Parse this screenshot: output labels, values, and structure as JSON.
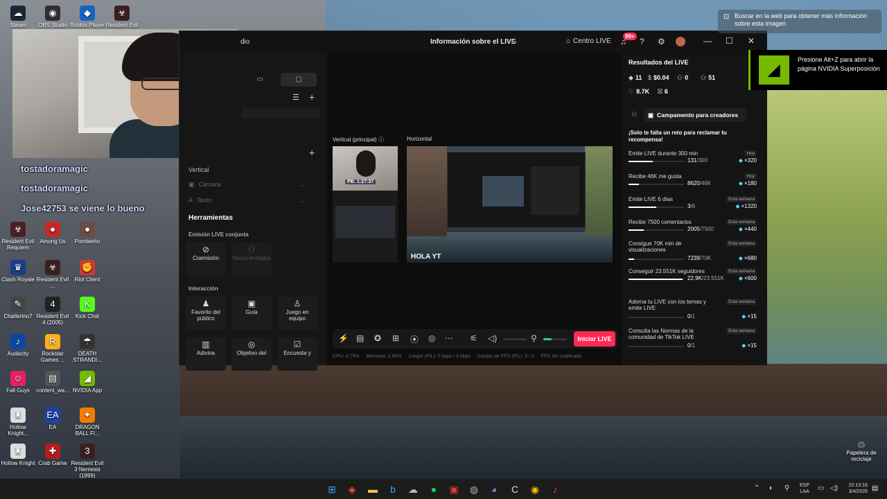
{
  "desktop_icons": [
    {
      "label": "Steam",
      "glyph": "☁",
      "color": "#1b2838"
    },
    {
      "label": "OBS Studio",
      "glyph": "◉",
      "color": "#302e31"
    },
    {
      "label": "Roblox Player",
      "glyph": "◆",
      "color": "#1565c0"
    },
    {
      "label": "Resident Evil ...",
      "glyph": "☣",
      "color": "#3b1f1f"
    },
    {
      "label": "Resident Evil Requiem",
      "glyph": "☣",
      "color": "#4a2020"
    },
    {
      "label": "Among Us",
      "glyph": "●",
      "color": "#c62828"
    },
    {
      "label": "Pomberito",
      "glyph": "●",
      "color": "#6d4c41"
    },
    {
      "label": "Clash Royale",
      "glyph": "♛",
      "color": "#1e3a8a"
    },
    {
      "label": "Resident Evil ...",
      "glyph": "☣",
      "color": "#3b1f1f"
    },
    {
      "label": "Riot Client",
      "glyph": "✊",
      "color": "#d13639"
    },
    {
      "label": "Chatterino7",
      "glyph": "✎",
      "color": "#444"
    },
    {
      "label": "Resident Evil 4 (2005)",
      "glyph": "4",
      "color": "#222"
    },
    {
      "label": "Kick Chat",
      "glyph": "K",
      "color": "#53fc18"
    },
    {
      "label": "Audacity",
      "glyph": "♪",
      "color": "#0d47a1"
    },
    {
      "label": "Rockstar Games ...",
      "glyph": "R",
      "color": "#fcaf17"
    },
    {
      "label": "DEATH STRANDI...",
      "glyph": "☂",
      "color": "#333"
    },
    {
      "label": "Fall Guys",
      "glyph": "☺",
      "color": "#e91e63"
    },
    {
      "label": "content_wa...",
      "glyph": "▤",
      "color": "#555"
    },
    {
      "label": "NVIDIA App",
      "glyph": "◢",
      "color": "#76b900"
    },
    {
      "label": "Hollow Knight...",
      "glyph": "♜",
      "color": "#ddd"
    },
    {
      "label": "EA",
      "glyph": "EA",
      "color": "#1e40af"
    },
    {
      "label": "DRAGON BALL Fi...",
      "glyph": "✦",
      "color": "#f57c00"
    },
    {
      "label": "Hollow Knight",
      "glyph": "♜",
      "color": "#ddd"
    },
    {
      "label": "Crab Game",
      "glyph": "✚",
      "color": "#b71c1c"
    },
    {
      "label": "Resident Evil 3 Nemesis (1999)",
      "glyph": "3",
      "color": "#3b1f1f"
    }
  ],
  "chat_overlay": [
    {
      "user": "tostadoramagic",
      "text": ""
    },
    {
      "user": "tostadoramagic",
      "text": ""
    },
    {
      "user": "Jose42753",
      "text": "se viene lo bueno"
    }
  ],
  "app": {
    "name": "dio",
    "title": "Información sobre el LIVE",
    "centro_live": "Centro LIVE",
    "notif_badge": "99+",
    "left": {
      "vertical_label": "Vertical",
      "sources": [
        "Cámara",
        "Texto"
      ],
      "tools_title": "Herramientas",
      "section_joint": "Emisión LIVE conjunta",
      "tools_joint": [
        {
          "label": "Coemisión",
          "icon": "⊘",
          "disabled": false
        },
        {
          "label": "Varios invitados",
          "icon": "⚇",
          "disabled": true
        }
      ],
      "section_interaction": "Interacción",
      "tools_interaction": [
        {
          "label": "Favorito del público",
          "icon": "♟",
          "disabled": false
        },
        {
          "label": "Guía",
          "icon": "▣",
          "disabled": false
        },
        {
          "label": "Juego en equipo",
          "icon": "♙",
          "disabled": false
        },
        {
          "label": "Adivina",
          "icon": "▥",
          "disabled": false
        },
        {
          "label": "Objetivo del",
          "icon": "◎",
          "disabled": false
        },
        {
          "label": "Encuesta y",
          "icon": "☑",
          "disabled": false
        }
      ]
    },
    "center": {
      "vertical_label": "Vertical (principal)",
      "horizontal_label": "Horizontal",
      "pb_text": "PB: 1:27:37",
      "hola_text": "HOLA YT",
      "start_button": "Iniciar LIVE",
      "status": {
        "cpu": "CPU: 4.75%",
        "memory": "Memoria: 2.98%",
        "upload": "Cargar (P/L): 0 kbps / 0 kbps",
        "fps_drops": "Caídas de FPS (P/L): 0 / 0",
        "encoder": "FPS del codificado"
      },
      "volume_level": 0.35
    },
    "right": {
      "title": "Resultados del LIVE",
      "stats": [
        {
          "icon": "◆",
          "value": "11"
        },
        {
          "icon": "$",
          "value": "$0.04"
        },
        {
          "icon": "⚇",
          "value": "0"
        },
        {
          "icon": "⚇",
          "value": "51"
        },
        {
          "icon": "♡",
          "value": "8.7K"
        },
        {
          "icon": "⛝",
          "value": "6"
        }
      ],
      "campaign_button": "Campamento para creadores",
      "reto_message": "¡Solo te falta un reto para reclamar tu recompensa!",
      "challenges": [
        {
          "title": "Emite LIVE durante 300 min",
          "tag": "Hoy",
          "current": "131",
          "target": "/300",
          "progress": 0.44,
          "reward": "×320"
        },
        {
          "title": "Recibe 46K me gusta",
          "tag": "Hoy",
          "current": "8620",
          "target": "/46K",
          "progress": 0.19,
          "reward": "×180"
        },
        {
          "title": "Emite LIVE 6 días",
          "tag": "Esta semana",
          "current": "3",
          "target": "/6",
          "progress": 0.5,
          "reward": "×1320"
        },
        {
          "title": "Recibe 7500 comentarios",
          "tag": "Esta semana",
          "current": "2005",
          "target": "/7500",
          "progress": 0.27,
          "reward": "×440"
        },
        {
          "title": "Consigue 70K min de visualizaciones",
          "tag": "Esta semana",
          "current": "7239",
          "target": "/70K",
          "progress": 0.1,
          "reward": "×680"
        },
        {
          "title": "Conseguir 23.551K seguidores",
          "tag": "Esta semana",
          "current": "22.9K",
          "target": "/23.551K",
          "progress": 0.97,
          "reward": "×600"
        },
        {
          "title": "Adorna tu LIVE con los temas y emite LIVE",
          "tag": "Esta semana",
          "current": "0",
          "target": "/1",
          "progress": 0,
          "reward": "×15"
        },
        {
          "title": "Consulta las Normas de la comunidad de TikTok LIVE",
          "tag": "Esta semana",
          "current": "0",
          "target": "/1",
          "progress": 0,
          "reward": "×15"
        }
      ]
    }
  },
  "web_tooltip": "Buscar en la web para obtener más información sobre esta imagen",
  "nvidia": {
    "text": "Presione Alt+Z para abrir la página NVIDIA Superposición"
  },
  "recycle_bin": "Papelera de reciclaje",
  "taskbar": {
    "apps": [
      {
        "name": "windows-start",
        "glyph": "⊞",
        "color": "#3a9bff"
      },
      {
        "name": "brave",
        "glyph": "◈",
        "color": "#fb542b"
      },
      {
        "name": "file-explorer",
        "glyph": "▬",
        "color": "#f5c242"
      },
      {
        "name": "bing",
        "glyph": "b",
        "color": "#2ea8ff"
      },
      {
        "name": "steam",
        "glyph": "☁",
        "color": "#bbb"
      },
      {
        "name": "spotify",
        "glyph": "●",
        "color": "#1ed760"
      },
      {
        "name": "tiktok-studio",
        "glyph": "▣",
        "color": "#e53935"
      },
      {
        "name": "chrome-dev",
        "glyph": "◍",
        "color": "#aaa"
      },
      {
        "name": "discord",
        "glyph": "◕",
        "color": "#7289da"
      },
      {
        "name": "ccleaner",
        "glyph": "C",
        "color": "#ddd"
      },
      {
        "name": "chrome",
        "glyph": "◉",
        "color": "#fbbc05"
      },
      {
        "name": "tiktok",
        "glyph": "♪",
        "color": "#fe2c55"
      }
    ],
    "lang": "ESP",
    "lang2": "LAA",
    "time": "22:13:16",
    "date": "3/4/2026"
  }
}
